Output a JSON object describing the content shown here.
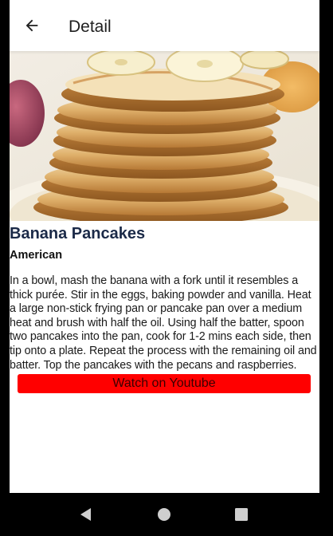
{
  "appbar": {
    "title": "Detail",
    "back_icon": "arrow-left-icon"
  },
  "recipe": {
    "image_description_icon": "pancake-stack-photo",
    "title": "Banana Pancakes",
    "area": "American",
    "instructions": "In a bowl, mash the banana with a fork until it resembles a thick purée. Stir in the eggs, baking powder and vanilla. Heat a large non-stick frying pan or pancake pan over a medium heat and brush with half the oil. Using half the batter, spoon two pancakes into the pan, cook for 1-2 mins each side, then tip onto a plate. Repeat the process with the remaining oil and batter. Top the pancakes with the pecans and raspberries."
  },
  "youtube_button": {
    "label": "Watch on Youtube"
  },
  "system_nav": {
    "back_icon": "triangle-back-icon",
    "home_icon": "circle-home-icon",
    "recents_icon": "square-recents-icon"
  },
  "colors": {
    "title": "#1b2a48",
    "button": "#ff0000",
    "navbar": "#000000",
    "screen_bg": "#ffffff"
  }
}
